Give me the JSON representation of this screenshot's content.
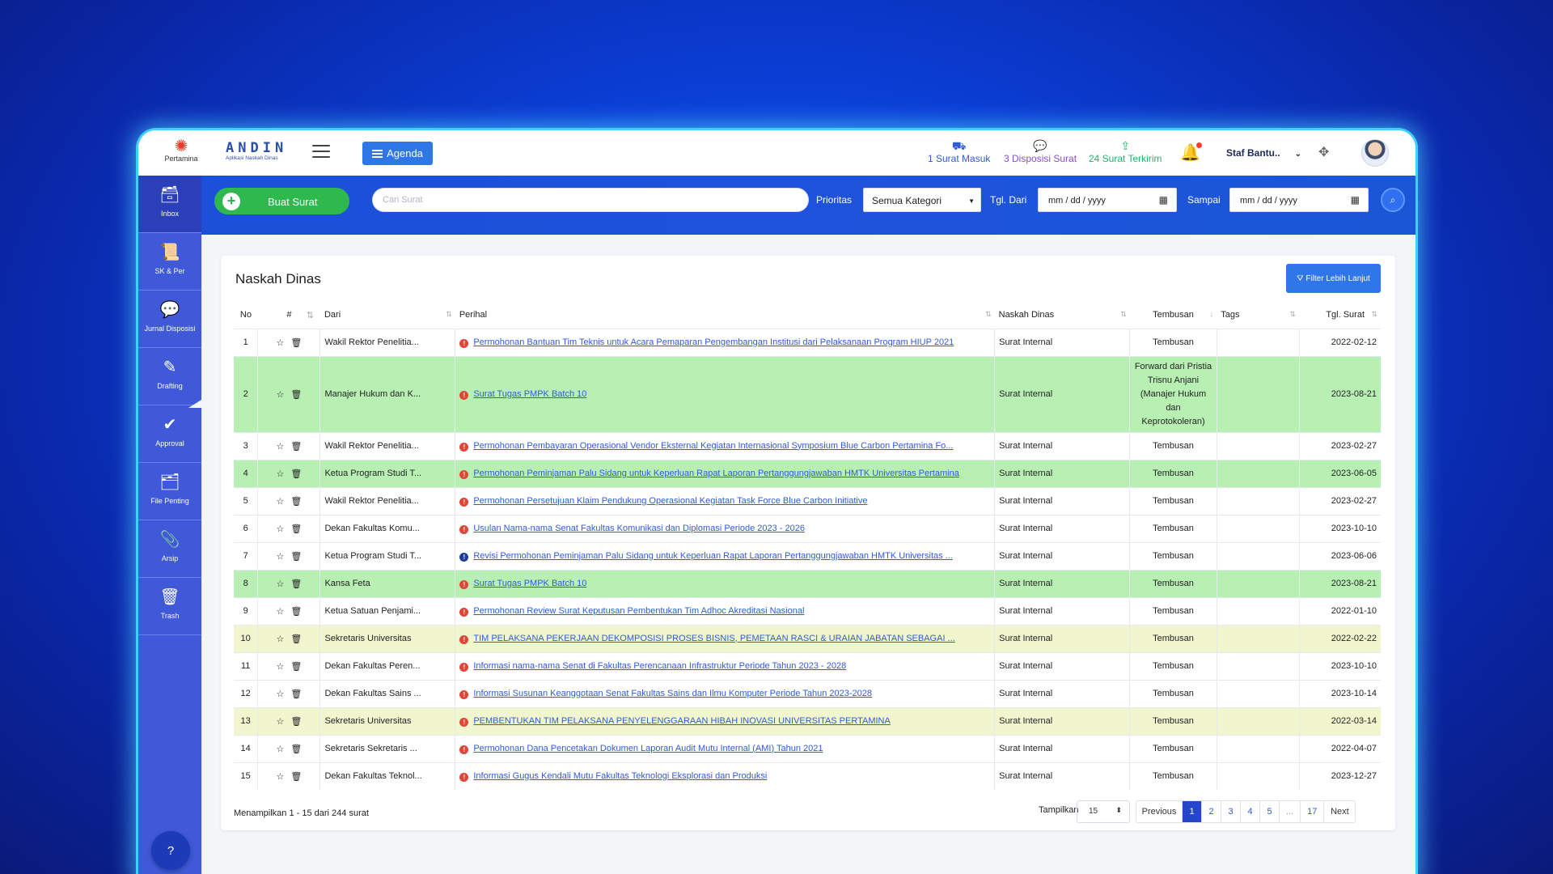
{
  "header": {
    "logo_text": "Pertamina",
    "app_name": "ANDIN",
    "app_subtitle": "Aplikasi Naskah Dinas",
    "agenda_label": "Agenda",
    "quick": [
      {
        "label": "1 Surat Masuk",
        "icon": "inbox-tray-icon"
      },
      {
        "label": "3 Disposisi Surat",
        "icon": "chat-bubbles-icon"
      },
      {
        "label": "24 Surat Terkirim",
        "icon": "sent-document-icon"
      }
    ],
    "user_name": "Staf Bantu.."
  },
  "searchbar": {
    "buat_label": "Buat Surat",
    "search_placeholder": "Cari Surat",
    "prioritas_label": "Prioritas",
    "prioritas_value": "Semua Kategori",
    "tgl_dari_label": "Tgl. Dari",
    "tgl_dari_value": "mm / dd / yyyy",
    "sampai_label": "Sampai",
    "sampai_value": "mm / dd / yyyy"
  },
  "sidebar": {
    "items": [
      {
        "label": "Inbox",
        "icon": "inbox-icon"
      },
      {
        "label": "SK & Per",
        "icon": "scroll-icon"
      },
      {
        "label": "Jurnal Disposisi",
        "icon": "comments-icon"
      },
      {
        "label": "Drafting",
        "icon": "pen-square-icon"
      },
      {
        "label": "Approval",
        "icon": "check-circle-icon"
      },
      {
        "label": "File Penting",
        "icon": "folder-icon"
      },
      {
        "label": "Arsip",
        "icon": "paperclip-icon"
      },
      {
        "label": "Trash",
        "icon": "trash-icon"
      }
    ]
  },
  "main": {
    "title": "Naskah Dinas",
    "filter_label": "Filter Lebih Lanjut",
    "columns": [
      "No",
      "#",
      "Dari",
      "Perihal",
      "Naskah Dinas",
      "Tembusan",
      "Tags",
      "Tgl. Surat"
    ],
    "rows": [
      {
        "no": "1",
        "dari": "Wakil Rektor Penelitia...",
        "perihal": "Permohonan Bantuan Tim Teknis untuk Acara Pemaparan Pengembangan Institusi dari Pelaksanaan Program HIUP 2021",
        "naskah": "Surat Internal",
        "tembusan": "Tembusan",
        "tgl": "2022-02-12",
        "hl": "",
        "prio": "red"
      },
      {
        "no": "2",
        "dari": "Manajer Hukum dan K...",
        "perihal": "Surat Tugas PMPK Batch 10",
        "naskah": "Surat Internal",
        "tembusan": "Forward dari Pristia Trisnu Anjani (Manajer Hukum dan Keprotokoleran)",
        "tgl": "2023-08-21",
        "hl": "green",
        "prio": "red"
      },
      {
        "no": "3",
        "dari": "Wakil Rektor Penelitia...",
        "perihal": "Permohonan Pembayaran Operasional Vendor Eksternal Kegiatan Internasional Symposium Blue Carbon Pertamina Fo...",
        "naskah": "Surat Internal",
        "tembusan": "Tembusan",
        "tgl": "2023-02-27",
        "hl": "",
        "prio": "red"
      },
      {
        "no": "4",
        "dari": "Ketua Program Studi T...",
        "perihal": "Permohonan Peminjaman Palu Sidang untuk Keperluan Rapat Laporan Pertanggungjawaban HMTK Universitas Pertamina",
        "naskah": "Surat Internal",
        "tembusan": "Tembusan",
        "tgl": "2023-06-05",
        "hl": "green",
        "prio": "red"
      },
      {
        "no": "5",
        "dari": "Wakil Rektor Penelitia...",
        "perihal": "Permohonan Persetujuan Klaim Pendukung Operasional Kegiatan Task Force Blue Carbon Initiative",
        "naskah": "Surat Internal",
        "tembusan": "Tembusan",
        "tgl": "2023-02-27",
        "hl": "",
        "prio": "red"
      },
      {
        "no": "6",
        "dari": "Dekan Fakultas Komu...",
        "perihal": "Usulan Nama-nama Senat Fakultas Komunikasi dan Diplomasi Periode 2023 - 2026",
        "naskah": "Surat Internal",
        "tembusan": "Tembusan",
        "tgl": "2023-10-10",
        "hl": "",
        "prio": "red"
      },
      {
        "no": "7",
        "dari": "Ketua Program Studi T...",
        "perihal": "Revisi Permohonan Peminjaman Palu Sidang untuk Keperluan Rapat Laporan Pertanggungjawaban HMTK Universitas ...",
        "naskah": "Surat Internal",
        "tembusan": "Tembusan",
        "tgl": "2023-06-06",
        "hl": "",
        "prio": "blue"
      },
      {
        "no": "8",
        "dari": "Kansa Feta",
        "perihal": "Surat Tugas PMPK Batch 10",
        "naskah": "Surat Internal",
        "tembusan": "Tembusan",
        "tgl": "2023-08-21",
        "hl": "green",
        "prio": "red"
      },
      {
        "no": "9",
        "dari": "Ketua Satuan Penjami...",
        "perihal": "Permohonan Review Surat Keputusan Pembentukan Tim Adhoc Akreditasi Nasional",
        "naskah": "Surat Internal",
        "tembusan": "Tembusan",
        "tgl": "2022-01-10",
        "hl": "",
        "prio": "red"
      },
      {
        "no": "10",
        "dari": "Sekretaris Universitas",
        "perihal": "TIM PELAKSANA PEKERJAAN DEKOMPOSISI PROSES BISNIS, PEMETAAN RASCI & URAIAN JABATAN SEBAGAI ...",
        "naskah": "Surat Internal",
        "tembusan": "Tembusan",
        "tgl": "2022-02-22",
        "hl": "yellow",
        "prio": "red"
      },
      {
        "no": "11",
        "dari": "Dekan Fakultas Peren...",
        "perihal": "Informasi nama-nama Senat di Fakultas Perencanaan Infrastruktur Periode Tahun 2023 - 2028",
        "naskah": "Surat Internal",
        "tembusan": "Tembusan",
        "tgl": "2023-10-10",
        "hl": "",
        "prio": "red"
      },
      {
        "no": "12",
        "dari": "Dekan Fakultas Sains ...",
        "perihal": "Informasi Susunan Keanggotaan Senat Fakultas Sains dan Ilmu Komputer Periode Tahun 2023-2028",
        "naskah": "Surat Internal",
        "tembusan": "Tembusan",
        "tgl": "2023-10-14",
        "hl": "",
        "prio": "red"
      },
      {
        "no": "13",
        "dari": "Sekretaris Universitas",
        "perihal": "PEMBENTUKAN TIM PELAKSANA PENYELENGGARAAN HIBAH INOVASI UNIVERSITAS PERTAMINA",
        "naskah": "Surat Internal",
        "tembusan": "Tembusan",
        "tgl": "2022-03-14",
        "hl": "yellow",
        "prio": "red"
      },
      {
        "no": "14",
        "dari": "Sekretaris Sekretaris ...",
        "perihal": "Permohonan Dana Pencetakan Dokumen Laporan Audit Mutu Internal (AMI) Tahun 2021",
        "naskah": "Surat Internal",
        "tembusan": "Tembusan",
        "tgl": "2022-04-07",
        "hl": "",
        "prio": "red"
      },
      {
        "no": "15",
        "dari": "Dekan Fakultas Teknol...",
        "perihal": "Informasi Gugus Kendali Mutu Fakultas Teknologi Eksplorasi dan Produksi",
        "naskah": "Surat Internal",
        "tembusan": "Tembusan",
        "tgl": "2023-12-27",
        "hl": "",
        "prio": "red"
      }
    ],
    "footer_info": "Menampilkan 1 - 15 dari 244 surat",
    "tampilkan_label": "Tampilkan",
    "tampilkan_value": "15",
    "pagination": [
      "Previous",
      "1",
      "2",
      "3",
      "4",
      "5",
      "...",
      "17",
      "Next"
    ]
  },
  "colors": {
    "accent": "#2f76e8",
    "sidebar": "#3f59d9",
    "green_row": "#b8f0b4",
    "yellow_row": "#f1f6cf",
    "danger": "#e24435"
  }
}
